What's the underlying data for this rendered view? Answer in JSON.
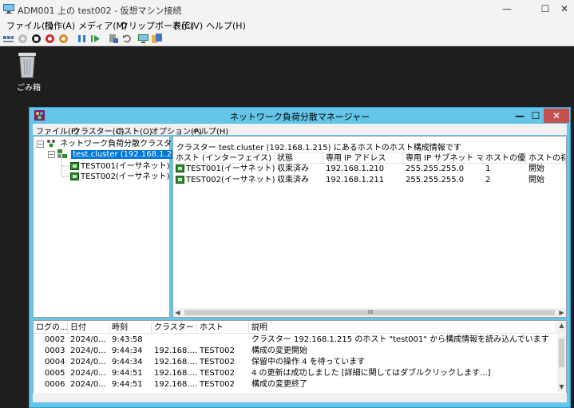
{
  "vm_window": {
    "title": "ADM001 上の test002 - 仮想マシン接続",
    "controls": {
      "minimize": "—",
      "maximize": "☐",
      "close": "✕"
    },
    "menu": [
      "ファイル(F)",
      "操作(A)",
      "メディア(M)",
      "クリップボード(C)",
      "表示(V)",
      "ヘルプ(H)"
    ],
    "toolbar_icons": [
      "ctrl-alt-del-icon",
      "start-icon",
      "turn-off-icon",
      "shutdown-icon",
      "power-icon",
      "pause-icon",
      "resume-icon",
      "checkpoint-icon",
      "revert-icon",
      "enhanced-session-icon",
      "share-icon"
    ]
  },
  "desktop": {
    "recycle_bin_label": "ごみ箱"
  },
  "nlb_manager": {
    "title": "ネットワーク負荷分散マネージャー",
    "controls": {
      "minimize": "—",
      "maximize": "☐",
      "close": "✕"
    },
    "menu": [
      "ファイル(F)",
      "クラスター(C)",
      "ホスト(O)",
      "オプション(P)",
      "ヘルプ(H)"
    ],
    "tree": {
      "root": "ネットワーク負荷分散クラスター",
      "cluster": "test.cluster (192.168.1.215)",
      "hosts": [
        "TEST001(イーサネット)",
        "TEST002(イーサネット)"
      ]
    },
    "detail": {
      "caption": "クラスター test.cluster (192.168.1.215) にあるホストのホスト構成情報です",
      "columns": [
        "ホスト (インターフェイス)",
        "状態",
        "専用 IP アドレス",
        "専用 IP サブネット マスク",
        "ホストの優...",
        "ホストの初期状"
      ],
      "rows": [
        [
          "TEST001(イーサネット)",
          "収束済み",
          "192.168.1.210",
          "255.255.255.0",
          "1",
          "開始"
        ],
        [
          "TEST002(イーサネット)",
          "収束済み",
          "192.168.1.211",
          "255.255.255.0",
          "2",
          "開始"
        ]
      ]
    },
    "log": {
      "columns": [
        "ログの...",
        "日付",
        "時刻",
        "クラスター",
        "ホスト",
        "説明"
      ],
      "rows": [
        [
          "0002",
          "2024/0...",
          "9:43:58",
          "",
          "",
          "クラスター 192.168.1.215 のホスト \"test001\" から構成情報を読み込んでいます"
        ],
        [
          "0003",
          "2024/0...",
          "9:44:34",
          "192.168....",
          "TEST002",
          "構成の変更開始"
        ],
        [
          "0004",
          "2024/0...",
          "9:44:34",
          "192.168....",
          "TEST002",
          "保留中の操作 4 を待っています"
        ],
        [
          "0005",
          "2024/0...",
          "9:44:51",
          "192.168....",
          "TEST002",
          "4 の更新は成功しました [詳細に関してはダブルクリックします...]"
        ],
        [
          "0006",
          "2024/0...",
          "9:44:51",
          "192.168....",
          "TEST002",
          "構成の変更終了"
        ]
      ]
    },
    "scroll_grip": "III"
  },
  "colors": {
    "nlb_title_bg": "#63c5e8",
    "selection_bg": "#0078d7",
    "close_red": "#c75050",
    "desktop_bg": "#1e1e1e"
  }
}
